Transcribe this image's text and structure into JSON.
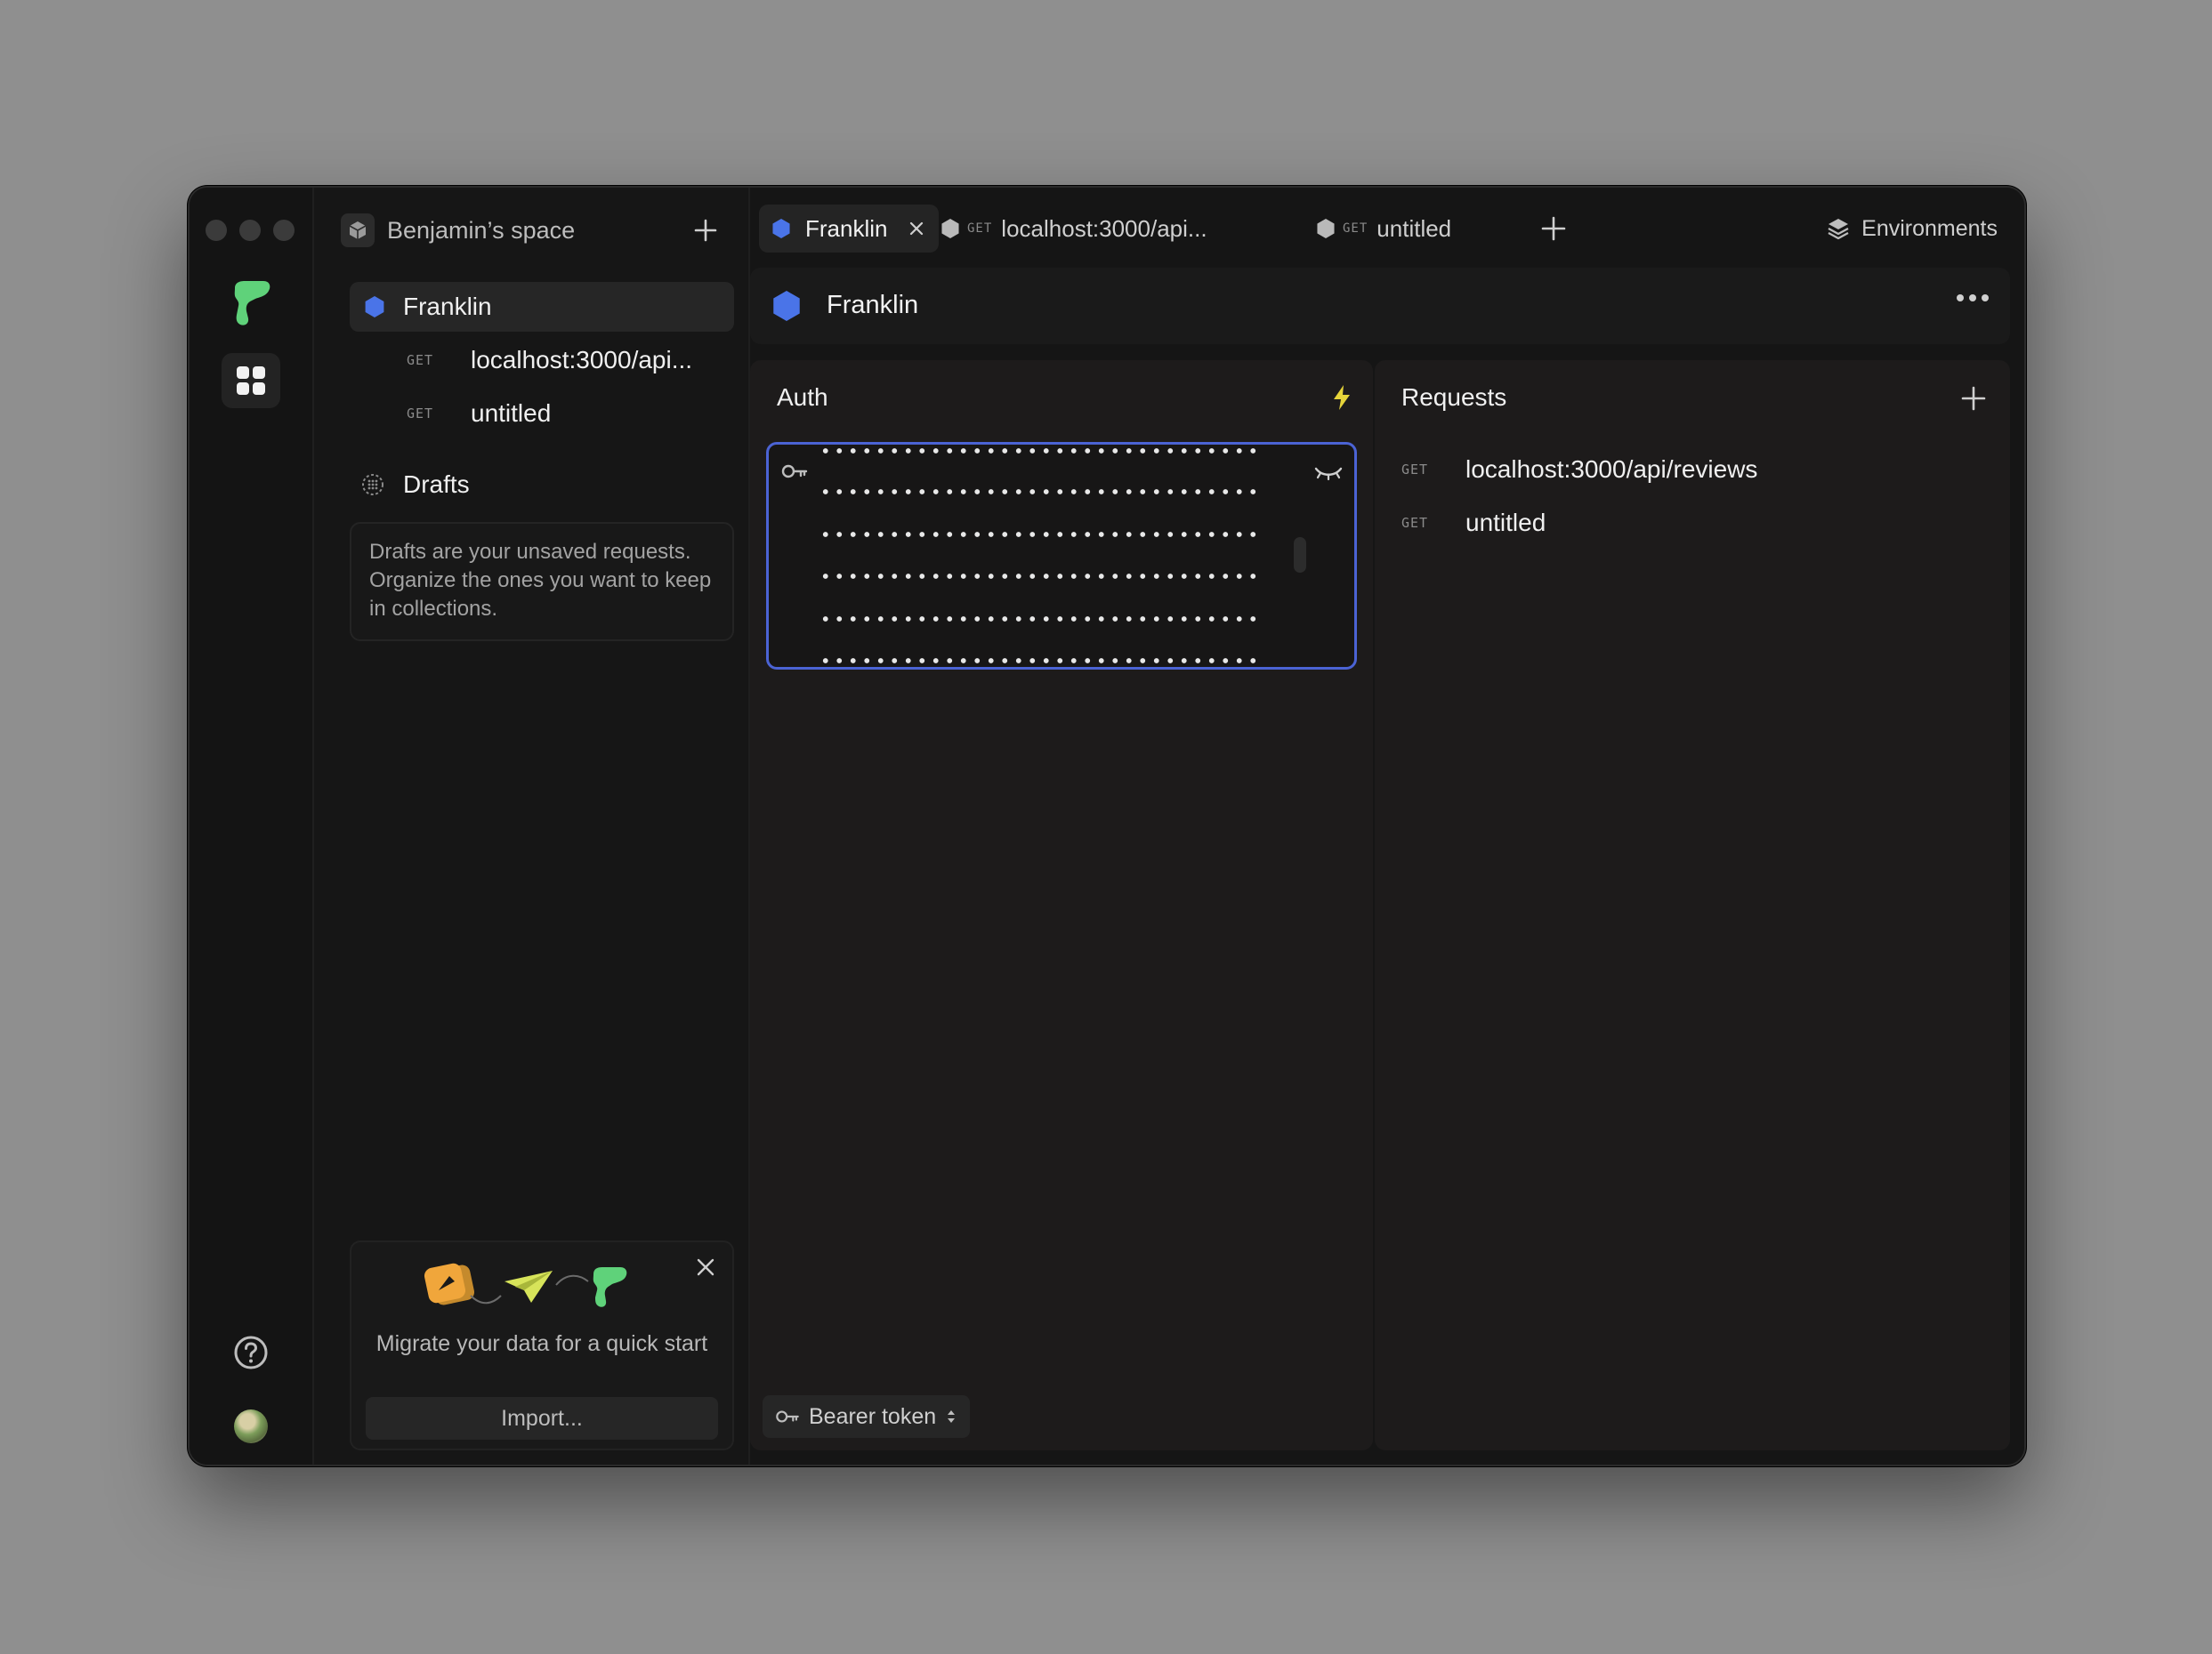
{
  "window": {
    "app": "Franklin"
  },
  "sidebar": {
    "space_name": "Benjamin’s space",
    "collection": {
      "name": "Franklin",
      "color": "#4a74e8"
    },
    "requests": [
      {
        "method": "GET",
        "label": "localhost:3000/api..."
      },
      {
        "method": "GET",
        "label": "untitled"
      }
    ],
    "drafts_label": "Drafts",
    "drafts_note": "Drafts are your unsaved requests. Organize the ones you want to keep in collections.",
    "migrate": {
      "text": "Migrate your data for a quick start",
      "import_label": "Import..."
    }
  },
  "tabs": [
    {
      "label": "Franklin",
      "method": "",
      "active": true
    },
    {
      "label": "localhost:3000/api...",
      "method": "GET",
      "active": false
    },
    {
      "label": "untitled",
      "method": "GET",
      "active": false
    }
  ],
  "environments_label": "Environments",
  "collection_header": {
    "title": "Franklin"
  },
  "auth": {
    "title": "Auth",
    "token_masked": true,
    "auth_type": "Bearer token"
  },
  "requests_panel": {
    "title": "Requests",
    "items": [
      {
        "method": "GET",
        "label": "localhost:3000/api/reviews"
      },
      {
        "method": "GET",
        "label": "untitled"
      }
    ]
  },
  "colors": {
    "accent": "#4a74e8",
    "brand_green": "#5fd27a",
    "lightning": "#e6d43a",
    "focus_border": "#4b63d4"
  },
  "icons": [
    "close-window-icon",
    "logo-icon",
    "apps-grid-icon",
    "help-icon",
    "cube-icon",
    "plus-icon",
    "hexagon-icon",
    "drafts-icon",
    "close-icon",
    "layers-icon",
    "more-icon",
    "lightning-icon",
    "key-icon",
    "eye-closed-icon",
    "chevron-updown-icon"
  ]
}
